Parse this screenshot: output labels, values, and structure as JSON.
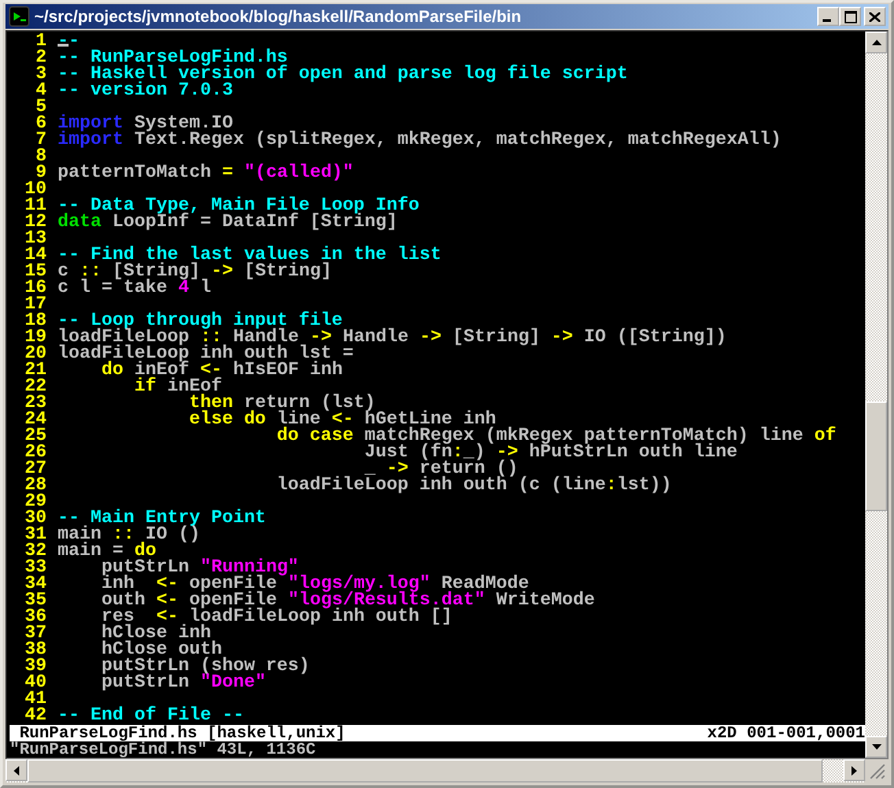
{
  "window": {
    "title": "~/src/projects/jvmnotebook/blog/haskell/RandomParseFile/bin"
  },
  "editor": {
    "lines": [
      {
        "number": "1",
        "cursor": true,
        "segments": [
          {
            "text": "--",
            "kind": "comment"
          }
        ]
      },
      {
        "number": "2",
        "cursor": false,
        "segments": [
          {
            "text": "-- RunParseLogFind.hs",
            "kind": "comment"
          }
        ]
      },
      {
        "number": "3",
        "cursor": false,
        "segments": [
          {
            "text": "-- Haskell version of open and parse log file script",
            "kind": "comment"
          }
        ]
      },
      {
        "number": "4",
        "cursor": false,
        "segments": [
          {
            "text": "-- version 7.0.3",
            "kind": "comment"
          }
        ]
      },
      {
        "number": "5",
        "cursor": false
      },
      {
        "number": "6",
        "cursor": false,
        "segments": [
          {
            "text": "import",
            "kind": "import"
          },
          {
            "text": " System.IO",
            "kind": "plain"
          }
        ]
      },
      {
        "number": "7",
        "cursor": false,
        "segments": [
          {
            "text": "import",
            "kind": "import"
          },
          {
            "text": " Text.Regex (splitRegex, mkRegex, matchRegex, matchRegexAll)",
            "kind": "plain"
          }
        ]
      },
      {
        "number": "8",
        "cursor": false
      },
      {
        "number": "9",
        "cursor": false,
        "segments": [
          {
            "text": "patternToMatch",
            "kind": "plain"
          },
          {
            "text": " =",
            "kind": "operator"
          },
          {
            "text": " \"(called)\"",
            "kind": "string"
          }
        ]
      },
      {
        "number": "10",
        "cursor": false
      },
      {
        "number": "11",
        "cursor": false,
        "segments": [
          {
            "text": "-- Data Type, Main File Loop Info",
            "kind": "comment"
          }
        ]
      },
      {
        "number": "12",
        "cursor": false,
        "segments": [
          {
            "text": "data",
            "kind": "data"
          },
          {
            "text": " LoopInf = DataInf [String]",
            "kind": "plain"
          }
        ]
      },
      {
        "number": "13",
        "cursor": false
      },
      {
        "number": "14",
        "cursor": false,
        "segments": [
          {
            "text": "-- Find the last values in the list",
            "kind": "comment"
          }
        ]
      },
      {
        "number": "15",
        "cursor": false,
        "segments": [
          {
            "text": "c",
            "kind": "plain"
          },
          {
            "text": " ::",
            "kind": "operator"
          },
          {
            "text": " [String]",
            "kind": "plain"
          },
          {
            "text": " ->",
            "kind": "operator"
          },
          {
            "text": " [String]",
            "kind": "plain"
          }
        ]
      },
      {
        "number": "16",
        "cursor": false,
        "segments": [
          {
            "text": "c l = take",
            "kind": "plain"
          },
          {
            "text": " 4",
            "kind": "number"
          },
          {
            "text": " l",
            "kind": "plain"
          }
        ]
      },
      {
        "number": "17",
        "cursor": false
      },
      {
        "number": "18",
        "cursor": false,
        "segments": [
          {
            "text": "-- Loop through input file",
            "kind": "comment"
          }
        ]
      },
      {
        "number": "19",
        "cursor": false,
        "segments": [
          {
            "text": "loadFileLoop",
            "kind": "plain"
          },
          {
            "text": " ::",
            "kind": "operator"
          },
          {
            "text": " Handle",
            "kind": "plain"
          },
          {
            "text": " ->",
            "kind": "operator"
          },
          {
            "text": " Handle",
            "kind": "plain"
          },
          {
            "text": " ->",
            "kind": "operator"
          },
          {
            "text": " [String]",
            "kind": "plain"
          },
          {
            "text": " ->",
            "kind": "operator"
          },
          {
            "text": " IO ([String])",
            "kind": "plain"
          }
        ]
      },
      {
        "number": "20",
        "cursor": false,
        "segments": [
          {
            "text": "loadFileLoop inh outh lst =",
            "kind": "plain"
          }
        ]
      },
      {
        "number": "21",
        "cursor": false,
        "segments": [
          {
            "text": "    do",
            "kind": "control"
          },
          {
            "text": " inEof",
            "kind": "plain"
          },
          {
            "text": " <-",
            "kind": "operator"
          },
          {
            "text": " hIsEOF inh",
            "kind": "plain"
          }
        ]
      },
      {
        "number": "22",
        "cursor": false,
        "segments": [
          {
            "text": "       if",
            "kind": "control"
          },
          {
            "text": " inEof",
            "kind": "plain"
          }
        ]
      },
      {
        "number": "23",
        "cursor": false,
        "segments": [
          {
            "text": "            then",
            "kind": "control"
          },
          {
            "text": " return (lst)",
            "kind": "plain"
          }
        ]
      },
      {
        "number": "24",
        "cursor": false,
        "segments": [
          {
            "text": "            else do",
            "kind": "control"
          },
          {
            "text": " line",
            "kind": "plain"
          },
          {
            "text": " <-",
            "kind": "operator"
          },
          {
            "text": " hGetLine inh",
            "kind": "plain"
          }
        ]
      },
      {
        "number": "25",
        "cursor": false,
        "segments": [
          {
            "text": "                    do case",
            "kind": "control"
          },
          {
            "text": " matchRegex (mkRegex patternToMatch) line",
            "kind": "plain"
          },
          {
            "text": " of",
            "kind": "control"
          }
        ]
      },
      {
        "number": "26",
        "cursor": false,
        "segments": [
          {
            "text": "                            Just (fn",
            "kind": "plain"
          },
          {
            "text": ":",
            "kind": "operator"
          },
          {
            "text": "_)",
            "kind": "plain"
          },
          {
            "text": " ->",
            "kind": "operator"
          },
          {
            "text": " hPutStrLn outh line",
            "kind": "plain"
          }
        ]
      },
      {
        "number": "27",
        "cursor": false,
        "segments": [
          {
            "text": "                            _",
            "kind": "plain"
          },
          {
            "text": " ->",
            "kind": "operator"
          },
          {
            "text": " return ()",
            "kind": "plain"
          }
        ]
      },
      {
        "number": "28",
        "cursor": false,
        "segments": [
          {
            "text": "                    loadFileLoop inh outh (c (line",
            "kind": "plain"
          },
          {
            "text": ":",
            "kind": "operator"
          },
          {
            "text": "lst))",
            "kind": "plain"
          }
        ]
      },
      {
        "number": "29",
        "cursor": false
      },
      {
        "number": "30",
        "cursor": false,
        "segments": [
          {
            "text": "-- Main Entry Point",
            "kind": "comment"
          }
        ]
      },
      {
        "number": "31",
        "cursor": false,
        "segments": [
          {
            "text": "main",
            "kind": "plain"
          },
          {
            "text": " ::",
            "kind": "operator"
          },
          {
            "text": " IO ()",
            "kind": "plain"
          }
        ]
      },
      {
        "number": "32",
        "cursor": false,
        "segments": [
          {
            "text": "main =",
            "kind": "plain"
          },
          {
            "text": " do",
            "kind": "control"
          }
        ]
      },
      {
        "number": "33",
        "cursor": false,
        "segments": [
          {
            "text": "    putStrLn",
            "kind": "plain"
          },
          {
            "text": " \"Running\"",
            "kind": "string"
          }
        ]
      },
      {
        "number": "34",
        "cursor": false,
        "segments": [
          {
            "text": "    inh",
            "kind": "plain"
          },
          {
            "text": "  <-",
            "kind": "operator"
          },
          {
            "text": " openFile",
            "kind": "plain"
          },
          {
            "text": " \"logs/my.log\"",
            "kind": "string"
          },
          {
            "text": " ReadMode",
            "kind": "plain"
          }
        ]
      },
      {
        "number": "35",
        "cursor": false,
        "segments": [
          {
            "text": "    outh",
            "kind": "plain"
          },
          {
            "text": " <-",
            "kind": "operator"
          },
          {
            "text": " openFile",
            "kind": "plain"
          },
          {
            "text": " \"logs/Results.dat\"",
            "kind": "string"
          },
          {
            "text": " WriteMode",
            "kind": "plain"
          }
        ]
      },
      {
        "number": "36",
        "cursor": false,
        "segments": [
          {
            "text": "    res",
            "kind": "plain"
          },
          {
            "text": "  <-",
            "kind": "operator"
          },
          {
            "text": " loadFileLoop inh outh []",
            "kind": "plain"
          }
        ]
      },
      {
        "number": "37",
        "cursor": false,
        "segments": [
          {
            "text": "    hClose inh",
            "kind": "plain"
          }
        ]
      },
      {
        "number": "38",
        "cursor": false,
        "segments": [
          {
            "text": "    hClose outh",
            "kind": "plain"
          }
        ]
      },
      {
        "number": "39",
        "cursor": false,
        "segments": [
          {
            "text": "    putStrLn (show res)",
            "kind": "plain"
          }
        ]
      },
      {
        "number": "40",
        "cursor": false,
        "segments": [
          {
            "text": "    putStrLn",
            "kind": "plain"
          },
          {
            "text": " \"Done\"",
            "kind": "string"
          }
        ]
      },
      {
        "number": "41",
        "cursor": false
      },
      {
        "number": "42",
        "cursor": false,
        "segments": [
          {
            "text": "-- End of File --",
            "kind": "comment"
          }
        ]
      }
    ]
  },
  "status_line": {
    "file": "RunParseLogFind.hs [haskell,unix]",
    "position": "x2D 001-001,0001"
  },
  "message_line": "\"RunParseLogFind.hs\" 43L, 1136C"
}
